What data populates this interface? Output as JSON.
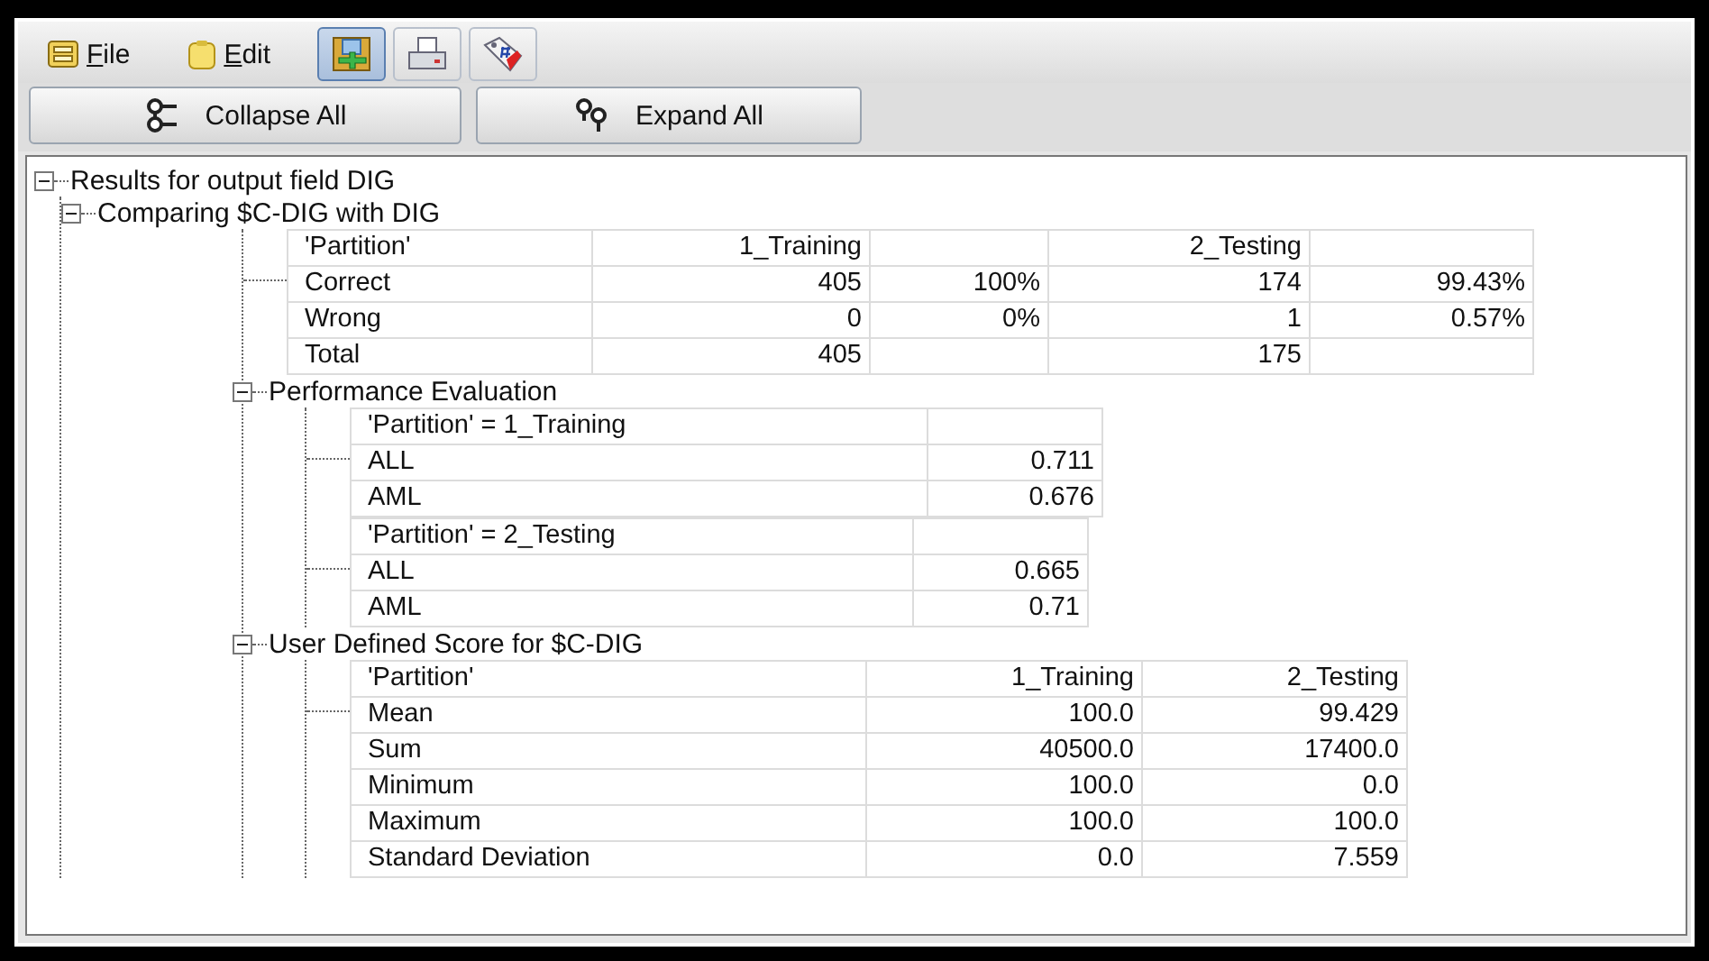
{
  "menu": [
    {
      "label": "File",
      "kind": "drawer"
    },
    {
      "label": "Edit",
      "kind": "clipboard"
    }
  ],
  "toolbar_icons": [
    {
      "kind": "add",
      "selected": true
    },
    {
      "kind": "print",
      "selected": false
    },
    {
      "kind": "tag",
      "selected": false
    }
  ],
  "buttons": [
    {
      "label": "Collapse All",
      "kind": "collapse"
    },
    {
      "label": "Expand All",
      "kind": "expand"
    }
  ],
  "tree": {
    "label": "Results for output field DIG",
    "expanded": true,
    "children": [
      {
        "kind": "node",
        "label": "Comparing $C-DIG with DIG",
        "expanded": true,
        "children": [
          {
            "kind": "table",
            "rows": [
              [
                "'Partition'",
                "1_Training",
                null,
                "2_Testing",
                null
              ],
              [
                "Correct",
                "405",
                "100%",
                "174",
                "99.43%"
              ],
              [
                "Wrong",
                "0",
                "0%",
                "1",
                "0.57%"
              ],
              [
                "Total",
                "405",
                null,
                "175",
                null
              ]
            ]
          },
          {
            "kind": "node",
            "label": "Performance Evaluation",
            "expanded": true,
            "children": [
              {
                "kind": "table",
                "rows": [
                  [
                    "'Partition' = 1_Training",
                    null
                  ],
                  [
                    "ALL",
                    "0.711"
                  ],
                  [
                    "AML",
                    "0.676"
                  ]
                ]
              },
              {
                "kind": "table",
                "rows": [
                  [
                    "'Partition' = 2_Testing",
                    null
                  ],
                  [
                    "ALL",
                    "0.665"
                  ],
                  [
                    "AML",
                    "0.71"
                  ]
                ]
              }
            ]
          },
          {
            "kind": "node",
            "label": "User Defined Score for $C-DIG",
            "expanded": true,
            "children": [
              {
                "kind": "table",
                "rows": [
                  [
                    "'Partition'",
                    "1_Training",
                    "2_Testing"
                  ],
                  [
                    "Mean",
                    "100.0",
                    "99.429"
                  ],
                  [
                    "Sum",
                    "40500.0",
                    "17400.0"
                  ],
                  [
                    "Minimum",
                    "100.0",
                    "0.0"
                  ],
                  [
                    "Maximum",
                    "100.0",
                    "100.0"
                  ],
                  [
                    "Standard Deviation",
                    "0.0",
                    "7.559"
                  ]
                ]
              }
            ]
          }
        ]
      }
    ]
  }
}
